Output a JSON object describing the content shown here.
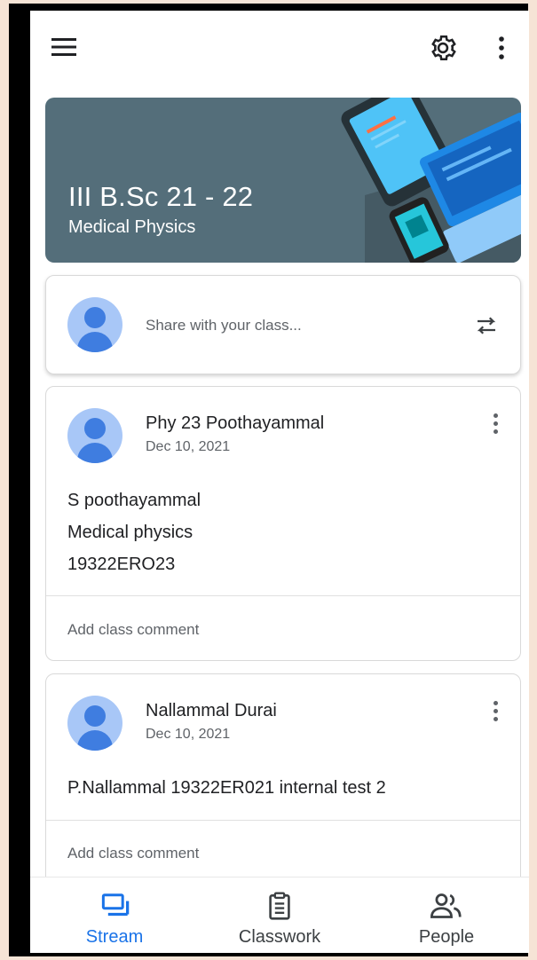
{
  "app": {
    "icons": {
      "menu": "menu-icon",
      "settings": "gear-icon",
      "more": "more-vertical-icon"
    }
  },
  "banner": {
    "title": "III B.Sc 21 - 22",
    "subtitle": "Medical Physics",
    "color": "#546e7a"
  },
  "share": {
    "placeholder": "Share with your class...",
    "icon": "repost-icon"
  },
  "posts": [
    {
      "author": "Phy 23 Poothayammal",
      "date": "Dec 10, 2021",
      "lines": [
        "S poothayammal",
        "Medical physics",
        "19322ERO23"
      ],
      "comment_placeholder": "Add class comment"
    },
    {
      "author": "Nallammal Durai",
      "date": "Dec 10, 2021",
      "lines": [
        "P.Nallammal 19322ER021 internal test 2"
      ],
      "comment_placeholder": "Add class comment"
    }
  ],
  "bottom_nav": {
    "items": [
      {
        "label": "Stream",
        "icon": "stream-icon",
        "active": true
      },
      {
        "label": "Classwork",
        "icon": "clipboard-icon",
        "active": false
      },
      {
        "label": "People",
        "icon": "people-icon",
        "active": false
      }
    ],
    "active_color": "#1a73e8"
  }
}
